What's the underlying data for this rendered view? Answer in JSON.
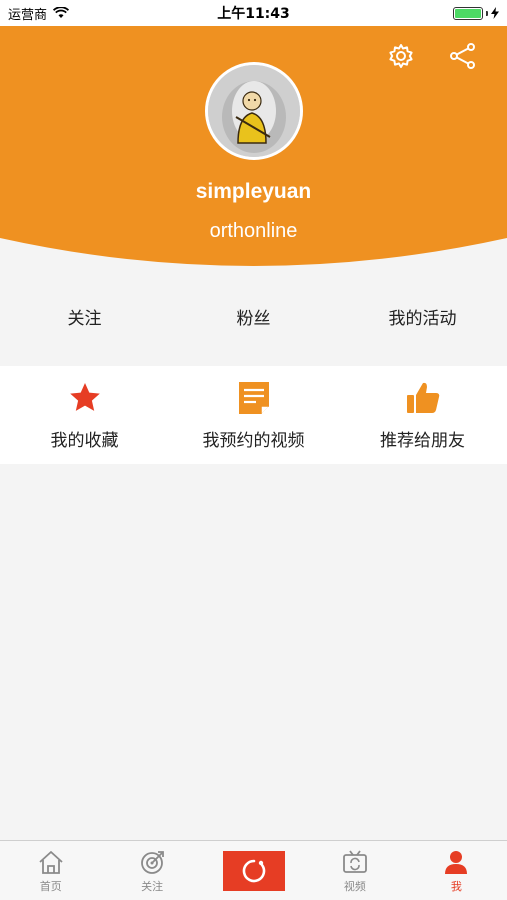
{
  "status_bar": {
    "carrier": "运营商",
    "time": "上午11:43",
    "battery_percent": 100
  },
  "colors": {
    "accent": "#ef9121",
    "red": "#e63d24",
    "background": "#f4f4f4"
  },
  "header": {
    "icons": [
      "gear-icon",
      "share-icon"
    ],
    "username": "simpleyuan",
    "userid": "orthonline"
  },
  "stats": [
    {
      "label": "关注"
    },
    {
      "label": "粉丝"
    },
    {
      "label": "我的活动"
    }
  ],
  "quick_actions": [
    {
      "label": "我的收藏",
      "icon": "star-icon"
    },
    {
      "label": "我预约的视频",
      "icon": "note-icon"
    },
    {
      "label": "推荐给朋友",
      "icon": "thumbs-up-icon"
    }
  ],
  "tabbar": {
    "tabs": [
      {
        "label": "首页",
        "icon": "home-icon"
      },
      {
        "label": "关注",
        "icon": "follow-icon"
      },
      {
        "label": "",
        "icon": "record-icon"
      },
      {
        "label": "视频",
        "icon": "video-icon"
      },
      {
        "label": "我",
        "icon": "user-icon"
      }
    ],
    "active": "我"
  }
}
